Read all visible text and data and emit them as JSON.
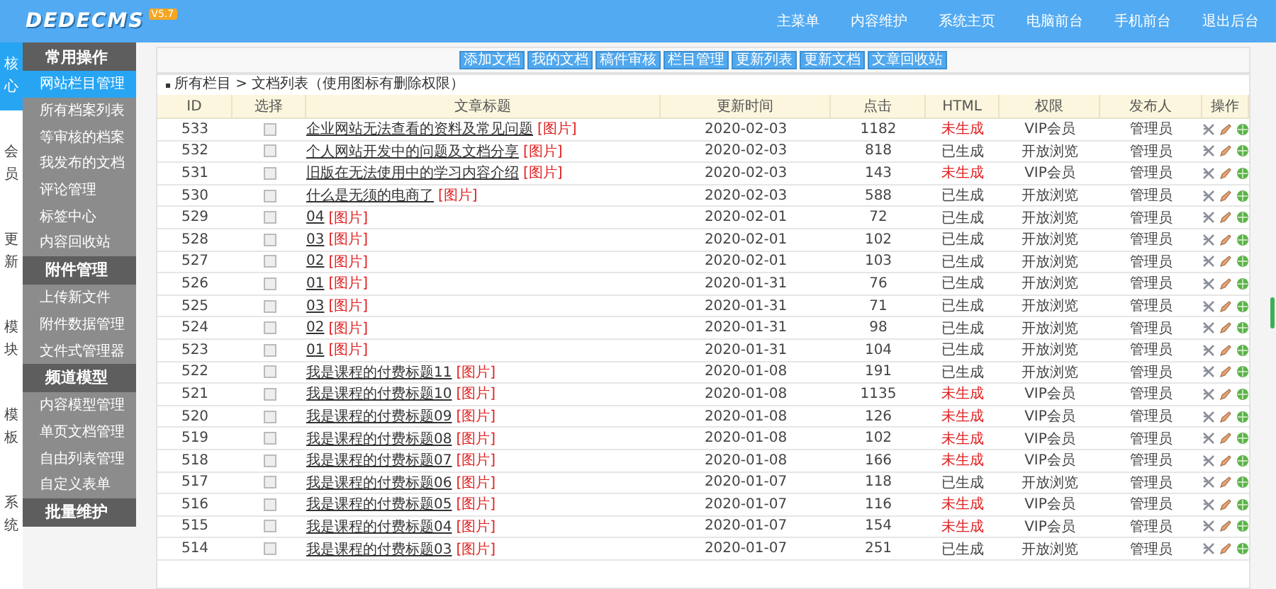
{
  "header": {
    "logo": "DEDECMS",
    "version": "V5.7",
    "nav": [
      {
        "label": "主菜单"
      },
      {
        "label": "内容维护"
      },
      {
        "label": "系统主页"
      },
      {
        "label": "电脑前台"
      },
      {
        "label": "手机前台"
      },
      {
        "label": "退出后台"
      }
    ]
  },
  "side_tabs": [
    {
      "label": "核心",
      "selected": true
    },
    {
      "label": "会员",
      "selected": false
    },
    {
      "label": "更新",
      "selected": false
    },
    {
      "label": "模块",
      "selected": false
    },
    {
      "label": "模板",
      "selected": false
    },
    {
      "label": "系统",
      "selected": false
    }
  ],
  "menu": [
    {
      "title": "常用操作",
      "items": [
        {
          "label": "网站栏目管理",
          "selected": true
        },
        {
          "label": "所有档案列表",
          "selected": false
        },
        {
          "label": "等审核的档案",
          "selected": false
        },
        {
          "label": "我发布的文档",
          "selected": false
        },
        {
          "label": "评论管理",
          "selected": false
        },
        {
          "label": "标签中心",
          "selected": false
        },
        {
          "label": "内容回收站",
          "selected": false
        }
      ]
    },
    {
      "title": "附件管理",
      "items": [
        {
          "label": "上传新文件",
          "selected": false
        },
        {
          "label": "附件数据管理",
          "selected": false
        },
        {
          "label": "文件式管理器",
          "selected": false
        }
      ]
    },
    {
      "title": "频道模型",
      "items": [
        {
          "label": "内容模型管理",
          "selected": false
        },
        {
          "label": "单页文档管理",
          "selected": false
        },
        {
          "label": "自由列表管理",
          "selected": false
        },
        {
          "label": "自定义表单",
          "selected": false
        }
      ]
    },
    {
      "title": "批量维护"
    }
  ],
  "toolbar": [
    "添加文档",
    "我的文档",
    "稿件审核",
    "栏目管理",
    "更新列表",
    "更新文档",
    "文章回收站"
  ],
  "breadcrumb": "所有栏目 > 文档列表（使用图标有删除权限）",
  "table": {
    "columns": [
      "ID",
      "选择",
      "文章标题",
      "更新时间",
      "点击",
      "HTML",
      "权限",
      "发布人",
      "操作"
    ],
    "rows": [
      {
        "checked": false,
        "id": "533",
        "title": "企业网站无法查看的资料及常见问题",
        "tag": "[图片]",
        "date": "2020-02-03",
        "clicks": "1182",
        "html": "未生成",
        "generated": false,
        "access": "VIP会员",
        "author": "管理员"
      },
      {
        "checked": false,
        "id": "532",
        "title": "个人网站开发中的问题及文档分享",
        "tag": "[图片]",
        "date": "2020-02-03",
        "clicks": "818",
        "html": "已生成",
        "generated": true,
        "access": "开放浏览",
        "author": "管理员"
      },
      {
        "checked": false,
        "id": "531",
        "title": "旧版在无法使用中的学习内容介绍",
        "tag": "[图片]",
        "date": "2020-02-03",
        "clicks": "143",
        "html": "未生成",
        "generated": false,
        "access": "VIP会员",
        "author": "管理员"
      },
      {
        "checked": false,
        "id": "530",
        "title": "什么是无须的电商了",
        "tag": "[图片]",
        "date": "2020-02-03",
        "clicks": "588",
        "html": "已生成",
        "generated": true,
        "access": "开放浏览",
        "author": "管理员"
      },
      {
        "checked": false,
        "id": "529",
        "title": "04",
        "tag": "[图片]",
        "date": "2020-02-01",
        "clicks": "72",
        "html": "已生成",
        "generated": true,
        "access": "开放浏览",
        "author": "管理员"
      },
      {
        "checked": false,
        "id": "528",
        "title": "03",
        "tag": "[图片]",
        "date": "2020-02-01",
        "clicks": "102",
        "html": "已生成",
        "generated": true,
        "access": "开放浏览",
        "author": "管理员"
      },
      {
        "checked": false,
        "id": "527",
        "title": "02",
        "tag": "[图片]",
        "date": "2020-02-01",
        "clicks": "103",
        "html": "已生成",
        "generated": true,
        "access": "开放浏览",
        "author": "管理员"
      },
      {
        "checked": false,
        "id": "526",
        "title": "01",
        "tag": "[图片]",
        "date": "2020-01-31",
        "clicks": "76",
        "html": "已生成",
        "generated": true,
        "access": "开放浏览",
        "author": "管理员"
      },
      {
        "checked": false,
        "id": "525",
        "title": "03",
        "tag": "[图片]",
        "date": "2020-01-31",
        "clicks": "71",
        "html": "已生成",
        "generated": true,
        "access": "开放浏览",
        "author": "管理员"
      },
      {
        "checked": false,
        "id": "524",
        "title": "02",
        "tag": "[图片]",
        "date": "2020-01-31",
        "clicks": "98",
        "html": "已生成",
        "generated": true,
        "access": "开放浏览",
        "author": "管理员"
      },
      {
        "checked": false,
        "id": "523",
        "title": "01",
        "tag": "[图片]",
        "date": "2020-01-31",
        "clicks": "104",
        "html": "已生成",
        "generated": true,
        "access": "开放浏览",
        "author": "管理员"
      },
      {
        "checked": false,
        "id": "522",
        "title": "我是课程的付费标题11",
        "tag": "[图片]",
        "date": "2020-01-08",
        "clicks": "191",
        "html": "已生成",
        "generated": true,
        "access": "开放浏览",
        "author": "管理员"
      },
      {
        "checked": false,
        "id": "521",
        "title": "我是课程的付费标题10",
        "tag": "[图片]",
        "date": "2020-01-08",
        "clicks": "1135",
        "html": "未生成",
        "generated": false,
        "access": "VIP会员",
        "author": "管理员"
      },
      {
        "checked": false,
        "id": "520",
        "title": "我是课程的付费标题09",
        "tag": "[图片]",
        "date": "2020-01-08",
        "clicks": "126",
        "html": "未生成",
        "generated": false,
        "access": "VIP会员",
        "author": "管理员"
      },
      {
        "checked": false,
        "id": "519",
        "title": "我是课程的付费标题08",
        "tag": "[图片]",
        "date": "2020-01-08",
        "clicks": "102",
        "html": "未生成",
        "generated": false,
        "access": "VIP会员",
        "author": "管理员"
      },
      {
        "checked": false,
        "id": "518",
        "title": "我是课程的付费标题07",
        "tag": "[图片]",
        "date": "2020-01-08",
        "clicks": "166",
        "html": "未生成",
        "generated": false,
        "access": "VIP会员",
        "author": "管理员"
      },
      {
        "checked": false,
        "id": "517",
        "title": "我是课程的付费标题06",
        "tag": "[图片]",
        "date": "2020-01-07",
        "clicks": "118",
        "html": "已生成",
        "generated": true,
        "access": "开放浏览",
        "author": "管理员"
      },
      {
        "checked": false,
        "id": "516",
        "title": "我是课程的付费标题05",
        "tag": "[图片]",
        "date": "2020-01-07",
        "clicks": "116",
        "html": "未生成",
        "generated": false,
        "access": "VIP会员",
        "author": "管理员"
      },
      {
        "checked": false,
        "id": "515",
        "title": "我是课程的付费标题04",
        "tag": "[图片]",
        "date": "2020-01-07",
        "clicks": "154",
        "html": "未生成",
        "generated": false,
        "access": "VIP会员",
        "author": "管理员"
      },
      {
        "checked": false,
        "id": "514",
        "title": "我是课程的付费标题03",
        "tag": "[图片]",
        "date": "2020-01-07",
        "clicks": "251",
        "html": "已生成",
        "generated": true,
        "access": "开放浏览",
        "author": "管理员"
      }
    ]
  }
}
